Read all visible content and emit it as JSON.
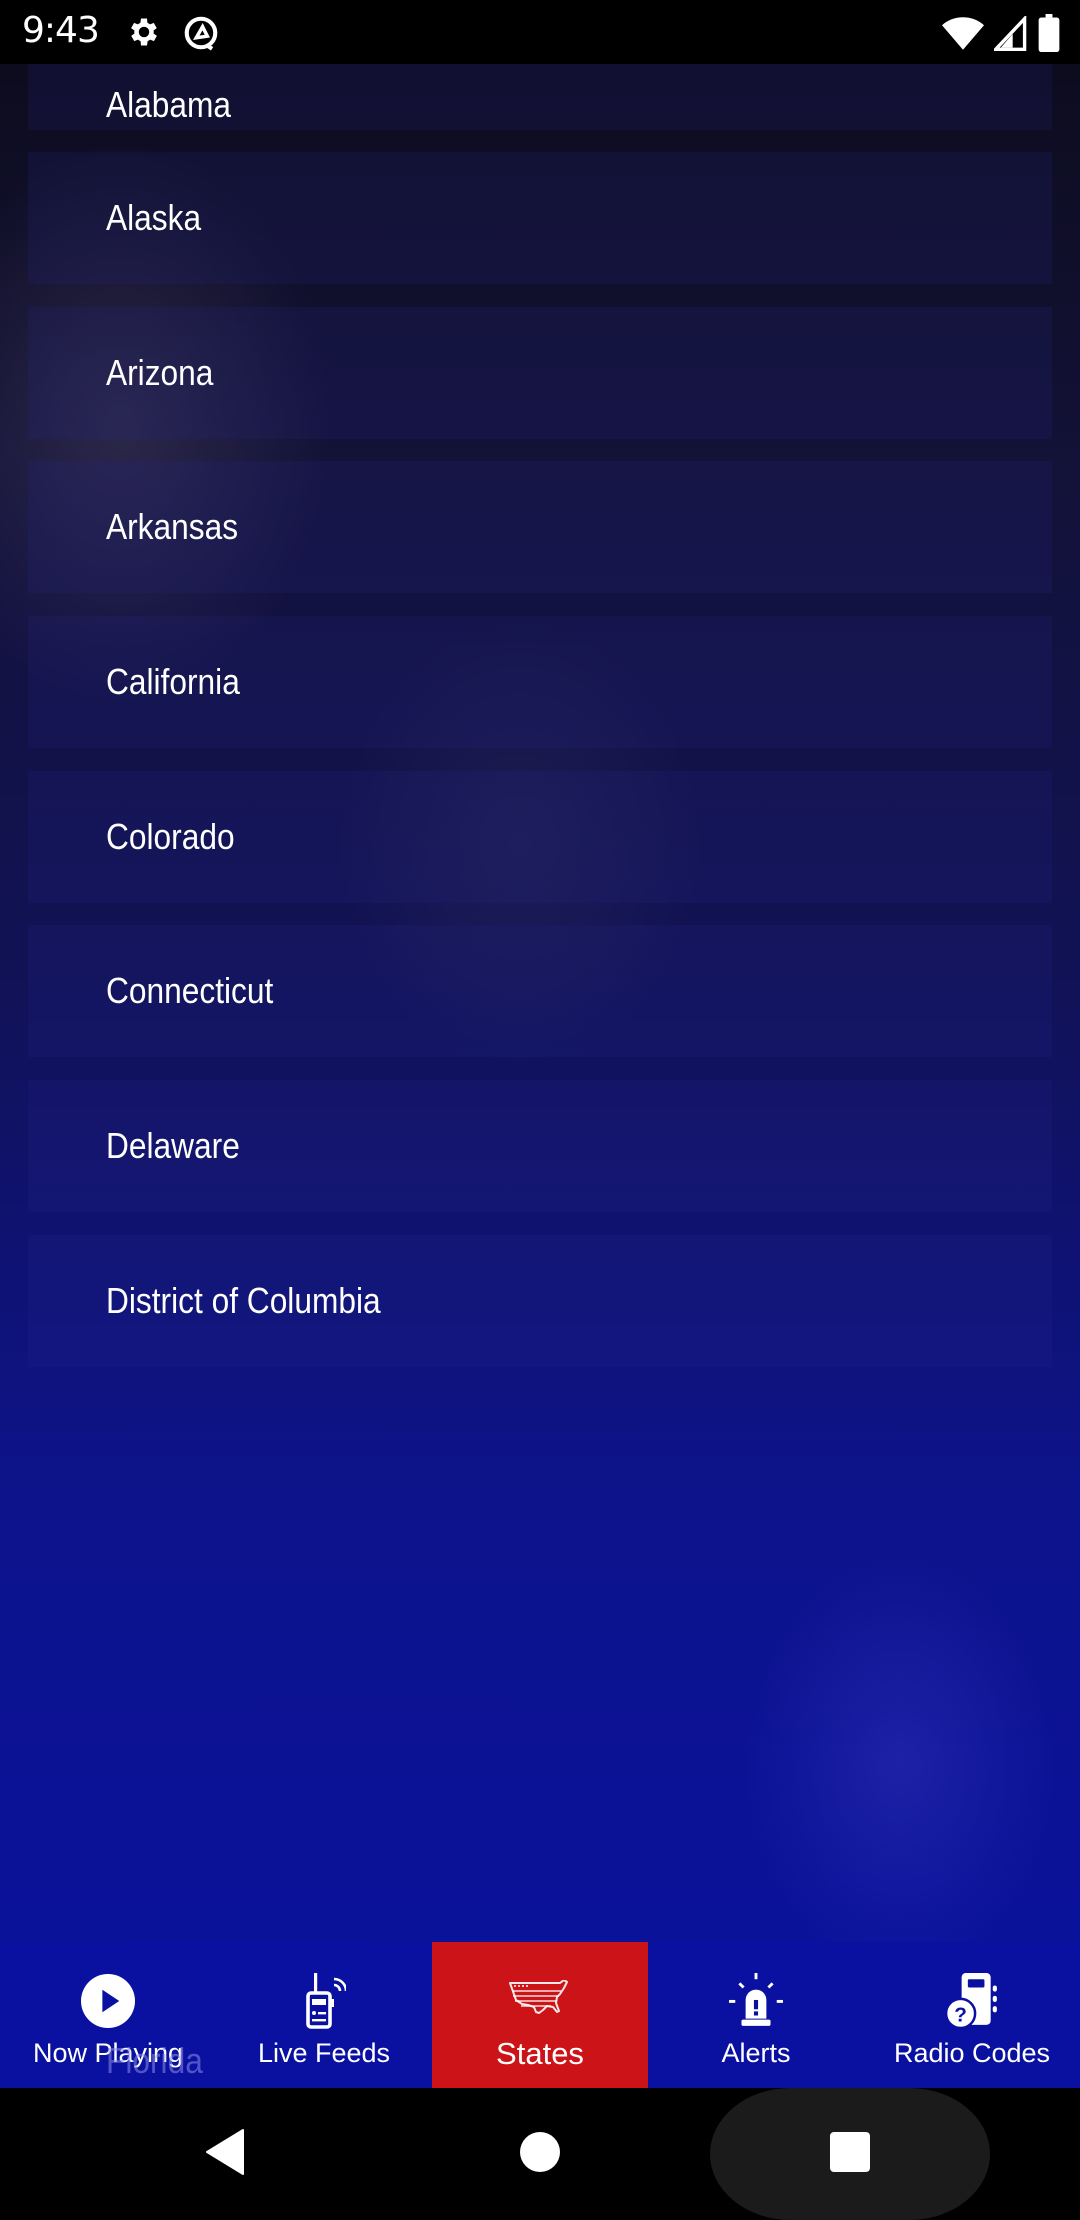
{
  "status_bar": {
    "time": "9:43",
    "left_icons": [
      "gear-icon",
      "at-sign-icon"
    ],
    "right_icons": [
      "wifi-icon",
      "cell-signal-icon",
      "battery-icon"
    ]
  },
  "states_list": {
    "items": [
      {
        "label": "Alabama"
      },
      {
        "label": "Alaska"
      },
      {
        "label": "Arizona"
      },
      {
        "label": "Arkansas"
      },
      {
        "label": "California"
      },
      {
        "label": "Colorado"
      },
      {
        "label": "Connecticut"
      },
      {
        "label": "Delaware"
      },
      {
        "label": "District of Columbia"
      }
    ],
    "partially_hidden_item": "Florida"
  },
  "bottom_nav": {
    "active_tab": "States",
    "items": [
      {
        "label": "Now Playing",
        "icon": "play-circle-icon"
      },
      {
        "label": "Live Feeds",
        "icon": "radio-handset-icon"
      },
      {
        "label": "States",
        "icon": "usa-flag-map-icon"
      },
      {
        "label": "Alerts",
        "icon": "siren-icon"
      },
      {
        "label": "Radio Codes",
        "icon": "radio-codes-icon"
      }
    ]
  },
  "colors": {
    "nav_background": "#0a11a0",
    "active_tab": "#cc1418",
    "text": "#ffffff"
  },
  "system_nav": {
    "buttons": [
      "back-icon",
      "home-icon",
      "recents-icon"
    ]
  }
}
